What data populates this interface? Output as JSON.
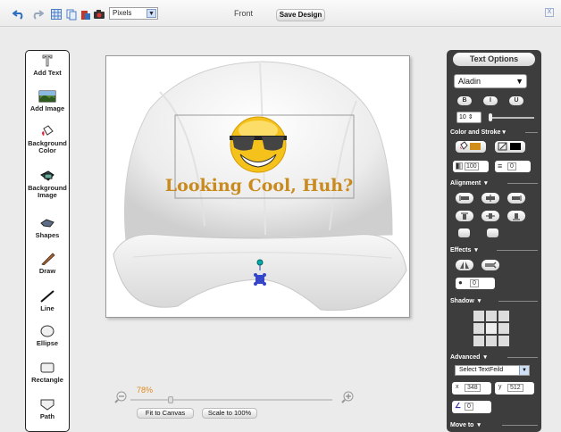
{
  "topbar": {
    "icons": [
      "undo-icon",
      "redo-icon",
      "grid-icon",
      "copy-icon",
      "paste-icon",
      "snapshot-icon"
    ],
    "units_select": "Pixels",
    "view_label": "Front",
    "save_label": "Save Design",
    "close_label": "X"
  },
  "tools": [
    {
      "label": "Add Text",
      "icon": "text-tool-icon"
    },
    {
      "label": "Add Image",
      "icon": "image-tool-icon"
    },
    {
      "label": "Background Color",
      "icon": "paint-bucket-icon"
    },
    {
      "label": "Background Image",
      "icon": "bg-image-icon"
    },
    {
      "label": "Shapes",
      "icon": "shapes-icon"
    },
    {
      "label": "Draw",
      "icon": "pencil-icon"
    },
    {
      "label": "Line",
      "icon": "line-icon"
    },
    {
      "label": "Ellipse",
      "icon": "ellipse-icon"
    },
    {
      "label": "Rectangle",
      "icon": "rectangle-icon"
    },
    {
      "label": "Path",
      "icon": "path-icon"
    }
  ],
  "canvas": {
    "design_text": "Looking Cool, Huh?",
    "text_color": "#c98a1e"
  },
  "zoom": {
    "percent": "78%",
    "fit_label": "Fit to Canvas",
    "scale_label": "Scale to 100%"
  },
  "panel": {
    "title": "Text Options",
    "font": "Aladin",
    "style_buttons": [
      "B",
      "I",
      "U"
    ],
    "font_size": "10",
    "color_stroke_label": "Color and Stroke",
    "opacity": "100",
    "stroke_width": "0",
    "fill_color": "#d08d1a",
    "stroke_color": "#000000",
    "alignment_label": "Alignment",
    "effects_label": "Effects",
    "effect_value": "0",
    "shadow_label": "Shadow",
    "advanced_label": "Advanced",
    "select_field": "Select TextFeild",
    "x_label": "x",
    "x_value": "348",
    "y_label": "y",
    "y_value": "512",
    "rotation": "0",
    "move_to_label": "Move to"
  }
}
